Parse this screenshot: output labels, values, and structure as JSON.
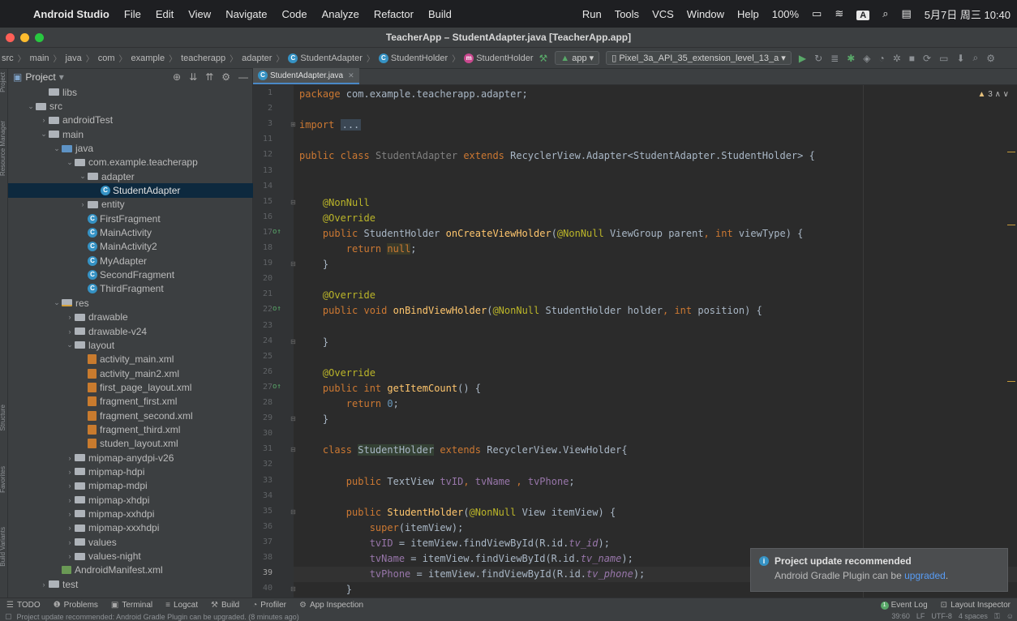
{
  "menubar": {
    "app": "Android Studio",
    "items": [
      "File",
      "Edit",
      "View",
      "Navigate",
      "Code",
      "Analyze",
      "Refactor",
      "Build",
      "Run",
      "Tools",
      "VCS",
      "Window",
      "Help"
    ],
    "battery": "100%",
    "input_method": "A",
    "clock": "5月7日 周三 10:40"
  },
  "window": {
    "title": "TeacherApp – StudentAdapter.java [TeacherApp.app]"
  },
  "breadcrumbs": [
    "src",
    "main",
    "java",
    "com",
    "example",
    "teacherapp",
    "adapter",
    "StudentAdapter",
    "StudentHolder",
    "StudentHolder"
  ],
  "toolbar": {
    "run_config": "app",
    "device": "Pixel_3a_API_35_extension_level_13_a"
  },
  "project_panel": {
    "title": "Project",
    "tree": [
      {
        "label": "libs",
        "depth": 3,
        "kind": "folder",
        "expand": ""
      },
      {
        "label": "src",
        "depth": 2,
        "kind": "folder",
        "expand": "open"
      },
      {
        "label": "androidTest",
        "depth": 3,
        "kind": "folder",
        "expand": "closed"
      },
      {
        "label": "main",
        "depth": 3,
        "kind": "folder",
        "expand": "open"
      },
      {
        "label": "java",
        "depth": 4,
        "kind": "folder-blue",
        "expand": "open"
      },
      {
        "label": "com.example.teacherapp",
        "depth": 5,
        "kind": "folder",
        "expand": "open"
      },
      {
        "label": "adapter",
        "depth": 6,
        "kind": "folder",
        "expand": "open"
      },
      {
        "label": "StudentAdapter",
        "depth": 7,
        "kind": "class",
        "expand": "",
        "selected": true
      },
      {
        "label": "entity",
        "depth": 6,
        "kind": "folder",
        "expand": "closed"
      },
      {
        "label": "FirstFragment",
        "depth": 6,
        "kind": "class",
        "expand": ""
      },
      {
        "label": "MainActivity",
        "depth": 6,
        "kind": "class",
        "expand": ""
      },
      {
        "label": "MainActivity2",
        "depth": 6,
        "kind": "class",
        "expand": ""
      },
      {
        "label": "MyAdapter",
        "depth": 6,
        "kind": "class",
        "expand": ""
      },
      {
        "label": "SecondFragment",
        "depth": 6,
        "kind": "class",
        "expand": ""
      },
      {
        "label": "ThirdFragment",
        "depth": 6,
        "kind": "class",
        "expand": ""
      },
      {
        "label": "res",
        "depth": 4,
        "kind": "folder-res",
        "expand": "open"
      },
      {
        "label": "drawable",
        "depth": 5,
        "kind": "folder",
        "expand": "closed"
      },
      {
        "label": "drawable-v24",
        "depth": 5,
        "kind": "folder",
        "expand": "closed"
      },
      {
        "label": "layout",
        "depth": 5,
        "kind": "folder",
        "expand": "open"
      },
      {
        "label": "activity_main.xml",
        "depth": 6,
        "kind": "xml",
        "expand": ""
      },
      {
        "label": "activity_main2.xml",
        "depth": 6,
        "kind": "xml",
        "expand": ""
      },
      {
        "label": "first_page_layout.xml",
        "depth": 6,
        "kind": "xml",
        "expand": ""
      },
      {
        "label": "fragment_first.xml",
        "depth": 6,
        "kind": "xml",
        "expand": ""
      },
      {
        "label": "fragment_second.xml",
        "depth": 6,
        "kind": "xml",
        "expand": ""
      },
      {
        "label": "fragment_third.xml",
        "depth": 6,
        "kind": "xml",
        "expand": ""
      },
      {
        "label": "studen_layout.xml",
        "depth": 6,
        "kind": "xml",
        "expand": ""
      },
      {
        "label": "mipmap-anydpi-v26",
        "depth": 5,
        "kind": "folder",
        "expand": "closed"
      },
      {
        "label": "mipmap-hdpi",
        "depth": 5,
        "kind": "folder",
        "expand": "closed"
      },
      {
        "label": "mipmap-mdpi",
        "depth": 5,
        "kind": "folder",
        "expand": "closed"
      },
      {
        "label": "mipmap-xhdpi",
        "depth": 5,
        "kind": "folder",
        "expand": "closed"
      },
      {
        "label": "mipmap-xxhdpi",
        "depth": 5,
        "kind": "folder",
        "expand": "closed"
      },
      {
        "label": "mipmap-xxxhdpi",
        "depth": 5,
        "kind": "folder",
        "expand": "closed"
      },
      {
        "label": "values",
        "depth": 5,
        "kind": "folder",
        "expand": "closed"
      },
      {
        "label": "values-night",
        "depth": 5,
        "kind": "folder",
        "expand": "closed"
      },
      {
        "label": "AndroidManifest.xml",
        "depth": 4,
        "kind": "manifest",
        "expand": ""
      },
      {
        "label": "test",
        "depth": 3,
        "kind": "folder",
        "expand": "closed"
      }
    ]
  },
  "left_strip": [
    "Project",
    "Resource Manager",
    "Structure",
    "Favorites",
    "Build Variants"
  ],
  "editor": {
    "tab": "StudentAdapter.java",
    "inspections": "3",
    "current_line": "39",
    "lines": [
      {
        "n": "1",
        "html": "<span class='kw'>package</span> com.example.teacherapp.adapter;"
      },
      {
        "n": "2",
        "html": ""
      },
      {
        "n": "3",
        "html": "<span class='kw'>import</span> <span class='fold-box'>...</span>",
        "fold": "⊞",
        "indent": -7
      },
      {
        "n": "11",
        "html": ""
      },
      {
        "n": "12",
        "html": "<span class='kw'>public class</span> <span class='gray'>StudentAdapter</span> <span class='kw'>extends</span> RecyclerView.Adapter&lt;StudentAdapter.StudentHolder&gt; {"
      },
      {
        "n": "13",
        "html": ""
      },
      {
        "n": "14",
        "html": ""
      },
      {
        "n": "15",
        "html": "    <span class='an'>@NonNull</span>",
        "fold": "⊟"
      },
      {
        "n": "16",
        "html": "    <span class='an'>@Override</span>"
      },
      {
        "n": "17",
        "html": "    <span class='kw'>public</span> StudentHolder <span class='fn'>onCreateViewHolder</span>(<span class='an'>@NonNull</span> ViewGroup parent<span class='kw'>,</span> <span class='kw'>int</span> viewType) {",
        "mark": "o↑"
      },
      {
        "n": "18",
        "html": "        <span class='kw'>return</span> <span class='kw hl'>null</span>;"
      },
      {
        "n": "19",
        "html": "    }",
        "fold": "⊟"
      },
      {
        "n": "20",
        "html": ""
      },
      {
        "n": "21",
        "html": "    <span class='an'>@Override</span>"
      },
      {
        "n": "22",
        "html": "    <span class='kw'>public void</span> <span class='fn'>onBindViewHolder</span>(<span class='an'>@NonNull</span> StudentHolder holder<span class='kw'>,</span> <span class='kw'>int</span> position) {",
        "mark": "o↑"
      },
      {
        "n": "23",
        "html": ""
      },
      {
        "n": "24",
        "html": "    }",
        "fold": "⊟"
      },
      {
        "n": "25",
        "html": ""
      },
      {
        "n": "26",
        "html": "    <span class='an'>@Override</span>"
      },
      {
        "n": "27",
        "html": "    <span class='kw'>public int</span> <span class='fn'>getItemCount</span>() {",
        "mark": "o↑"
      },
      {
        "n": "28",
        "html": "        <span class='kw'>return</span> <span class='num'>0</span>;"
      },
      {
        "n": "29",
        "html": "    }",
        "fold": "⊟"
      },
      {
        "n": "30",
        "html": ""
      },
      {
        "n": "31",
        "html": "    <span class='kw'>class</span> <span class='hlb'>StudentHolder</span> <span class='kw'>extends</span> RecyclerView.ViewHolder{",
        "fold": "⊟"
      },
      {
        "n": "32",
        "html": ""
      },
      {
        "n": "33",
        "html": "        <span class='kw'>public</span> TextView <span class='fdn'>tvID</span><span class='kw'>,</span> <span class='fdn'>tvName</span> <span class='kw'>,</span> <span class='fdn'>tvPhone</span>;"
      },
      {
        "n": "34",
        "html": ""
      },
      {
        "n": "35",
        "html": "        <span class='kw'>public</span> <span class='fn'>StudentHolder</span>(<span class='an'>@NonNull</span> View itemView) {",
        "fold": "⊟"
      },
      {
        "n": "36",
        "html": "            <span class='kw'>super</span>(itemView);"
      },
      {
        "n": "37",
        "html": "            <span class='fdn'>tvID</span> = itemView.findViewById(R.id.<span class='fd'>tv_id</span>);"
      },
      {
        "n": "38",
        "html": "            <span class='fdn'>tvName</span> = itemView.findViewById(R.id.<span class='fd'>tv_name</span>);"
      },
      {
        "n": "39",
        "html": "            <span class='fdn'>tvPhone</span> = itemView.findViewById(R.id.<span class='fd'>tv_phone</span>);"
      },
      {
        "n": "40",
        "html": "        }",
        "fold": "⊟"
      }
    ]
  },
  "notification": {
    "title": "Project update recommended",
    "body_prefix": "Android Gradle Plugin can be ",
    "link": "upgraded",
    "body_suffix": "."
  },
  "bottom_tools": [
    {
      "icon": "☰",
      "label": "TODO"
    },
    {
      "icon": "❶",
      "label": "Problems"
    },
    {
      "icon": "▣",
      "label": "Terminal"
    },
    {
      "icon": "≡",
      "label": "Logcat"
    },
    {
      "icon": "⚒",
      "label": "Build"
    },
    {
      "icon": "◔",
      "label": "Profiler"
    },
    {
      "icon": "⚙",
      "label": "App Inspection"
    }
  ],
  "bottom_right": {
    "event_log": "Event Log",
    "layout_inspector": "Layout Inspector"
  },
  "status": {
    "message": "Project update recommended: Android Gradle Plugin can be upgraded. (8 minutes ago)",
    "position": "39:60",
    "line_sep": "LF",
    "encoding": "UTF-8",
    "indent": "4 spaces"
  }
}
